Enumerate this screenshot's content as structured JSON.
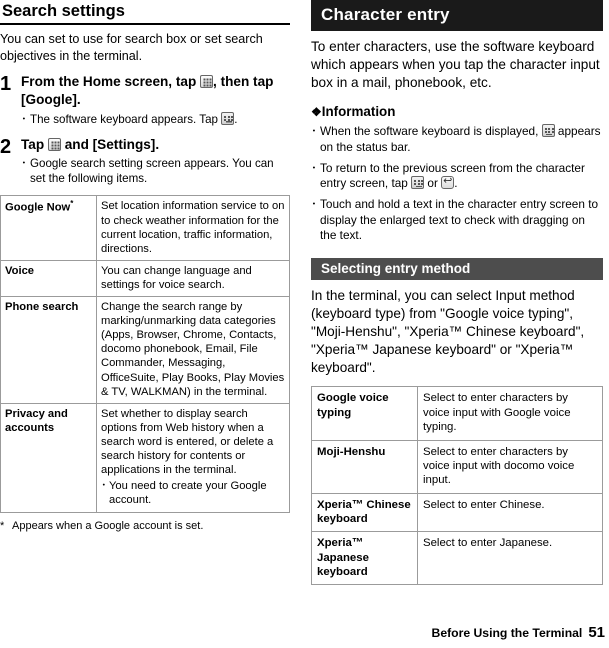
{
  "left": {
    "heading": "Search settings",
    "intro": "You can set to use for search box or set search objectives in the terminal.",
    "steps": [
      {
        "num": "1",
        "title_parts": [
          "From the Home screen, tap ",
          ", then tap [Google]."
        ],
        "bullets": [
          {
            "text_before": "The software keyboard appears. Tap ",
            "text_after": "."
          }
        ]
      },
      {
        "num": "2",
        "title_parts": [
          "Tap ",
          " and [Settings]."
        ],
        "bullets": [
          {
            "text_before": "Google search setting screen appears. You can set the following items.",
            "text_after": ""
          }
        ]
      }
    ],
    "table": [
      {
        "key": "Google Now",
        "key_sup": "*",
        "value": "Set location information service to on to check weather information for the current location, traffic information, directions."
      },
      {
        "key": "Voice",
        "key_sup": "",
        "value": "You can change language and settings for voice search."
      },
      {
        "key": "Phone search",
        "key_sup": "",
        "value": "Change the search range by marking/unmarking data categories (Apps, Browser, Chrome, Contacts, docomo phonebook, Email, File Commander, Messaging, OfficeSuite, Play Books, Play Movies & TV, WALKMAN) in the terminal."
      },
      {
        "key": "Privacy and accounts",
        "key_sup": "",
        "value": "Set whether to display search options from Web history when a search word is entered, or delete a search history for contents or applications in the terminal.",
        "sub": "You need to create your Google account."
      }
    ],
    "footnote": {
      "star": "*",
      "text": "Appears when a Google account is set."
    }
  },
  "right": {
    "title": "Character entry",
    "intro": "To enter characters, use the software keyboard which appears when you tap the character input box in a mail, phonebook, etc.",
    "info_heading": "Information",
    "info_bullets": [
      {
        "before": "When the software keyboard is displayed, ",
        "after": " appears on the status bar."
      },
      {
        "before": "To return to the previous screen from the character entry screen, tap ",
        "middle": " or ",
        "after": "."
      },
      {
        "before": "Touch and hold a text in the character entry screen to display the enlarged text to check with dragging on the text.",
        "after": ""
      }
    ],
    "subsection": "Selecting entry method",
    "subsection_body": "In the terminal, you can select Input method (keyboard type) from \"Google voice typing\", \"Moji-Henshu\", \"Xperia™ Chinese keyboard\", \"Xperia™ Japanese keyboard\" or \"Xperia™ keyboard\".",
    "table": [
      {
        "key": "Google voice typing",
        "value": "Select to enter characters by voice input with Google voice typing."
      },
      {
        "key": "Moji-Henshu",
        "value": "Select to enter characters by voice input with docomo voice input."
      },
      {
        "key": "Xperia™ Chinese keyboard",
        "value": "Select to enter Chinese."
      },
      {
        "key": "Xperia™ Japanese keyboard",
        "value": "Select to enter Japanese."
      }
    ]
  },
  "footer": {
    "text": "Before Using the Terminal",
    "page": "51"
  },
  "colors": {
    "title_bar": "#1a1a1a",
    "sub_bar": "#4d4d4d",
    "table_border": "#9b9b9b"
  }
}
